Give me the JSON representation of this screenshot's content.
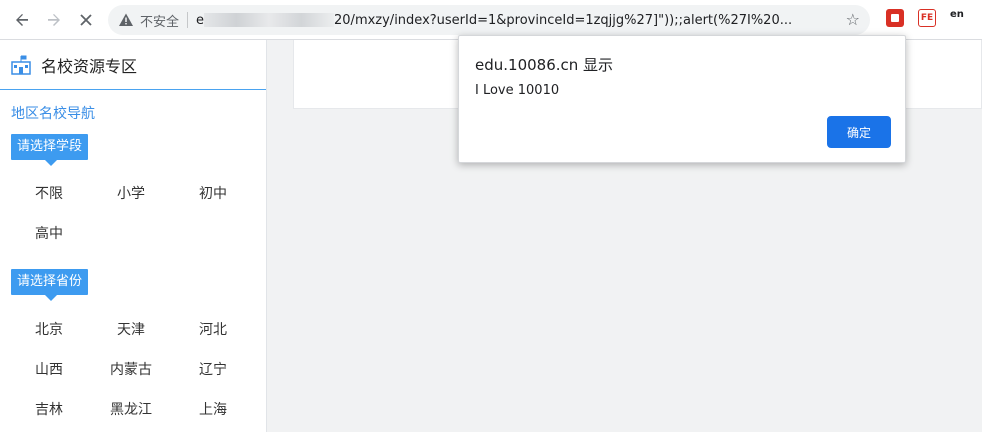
{
  "browser": {
    "security_label": "不安全",
    "url_prefix": "e",
    "url_suffix": "20/mxzy/index?userId=1&provinceId=1zqjjg%27]\"));;alert(%27I%20..."
  },
  "sidebar": {
    "title": "名校资源专区",
    "region_link": "地区名校导航",
    "stage_tag": "请选择学段",
    "stages": [
      "不限",
      "小学",
      "初中",
      "高中"
    ],
    "province_tag": "请选择省份",
    "provinces": [
      "北京",
      "天津",
      "河北",
      "山西",
      "内蒙古",
      "辽宁",
      "吉林",
      "黑龙江",
      "上海"
    ]
  },
  "dialog": {
    "title": "edu.10086.cn 显示",
    "message": "I Love 10010",
    "ok_label": "确定"
  },
  "extensions": {
    "ext2_label": "FE",
    "ext3_label": "en"
  }
}
